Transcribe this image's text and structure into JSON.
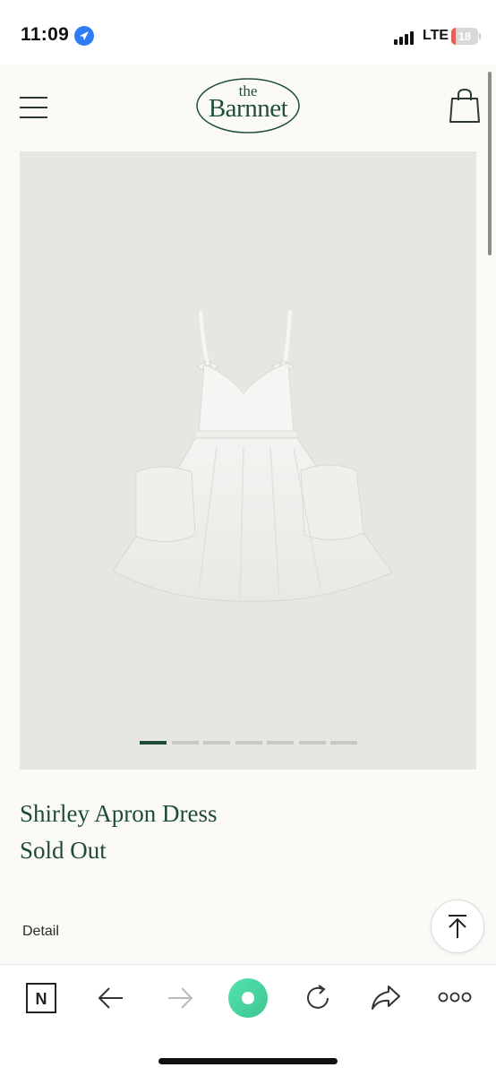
{
  "status_bar": {
    "time": "11:09",
    "network": "LTE",
    "battery_level": "18",
    "battery_fraction": 0.18
  },
  "header": {
    "logo_small": "the",
    "logo_main": "Barnnet"
  },
  "gallery": {
    "image_count": 7,
    "active_index": 0,
    "active_color": "#1e4d36",
    "inactive_color": "#c9c7c3"
  },
  "product": {
    "name": "Shirley Apron Dress",
    "status": "Sold Out"
  },
  "detail": {
    "label": "Detail"
  },
  "colors": {
    "brand_green": "#1e4d36",
    "background": "#fbfaf6",
    "accent_button": "#4fd6a6"
  },
  "icons": {
    "menu": "hamburger-menu-icon",
    "cart": "shopping-bag-icon",
    "to_top": "arrow-up-to-top-icon",
    "naver": "naver-n-icon",
    "back": "arrow-left-icon",
    "forward": "arrow-right-icon",
    "green_dot": "green-dot-icon",
    "refresh": "refresh-icon",
    "share": "share-icon",
    "more": "more-dots-icon"
  }
}
